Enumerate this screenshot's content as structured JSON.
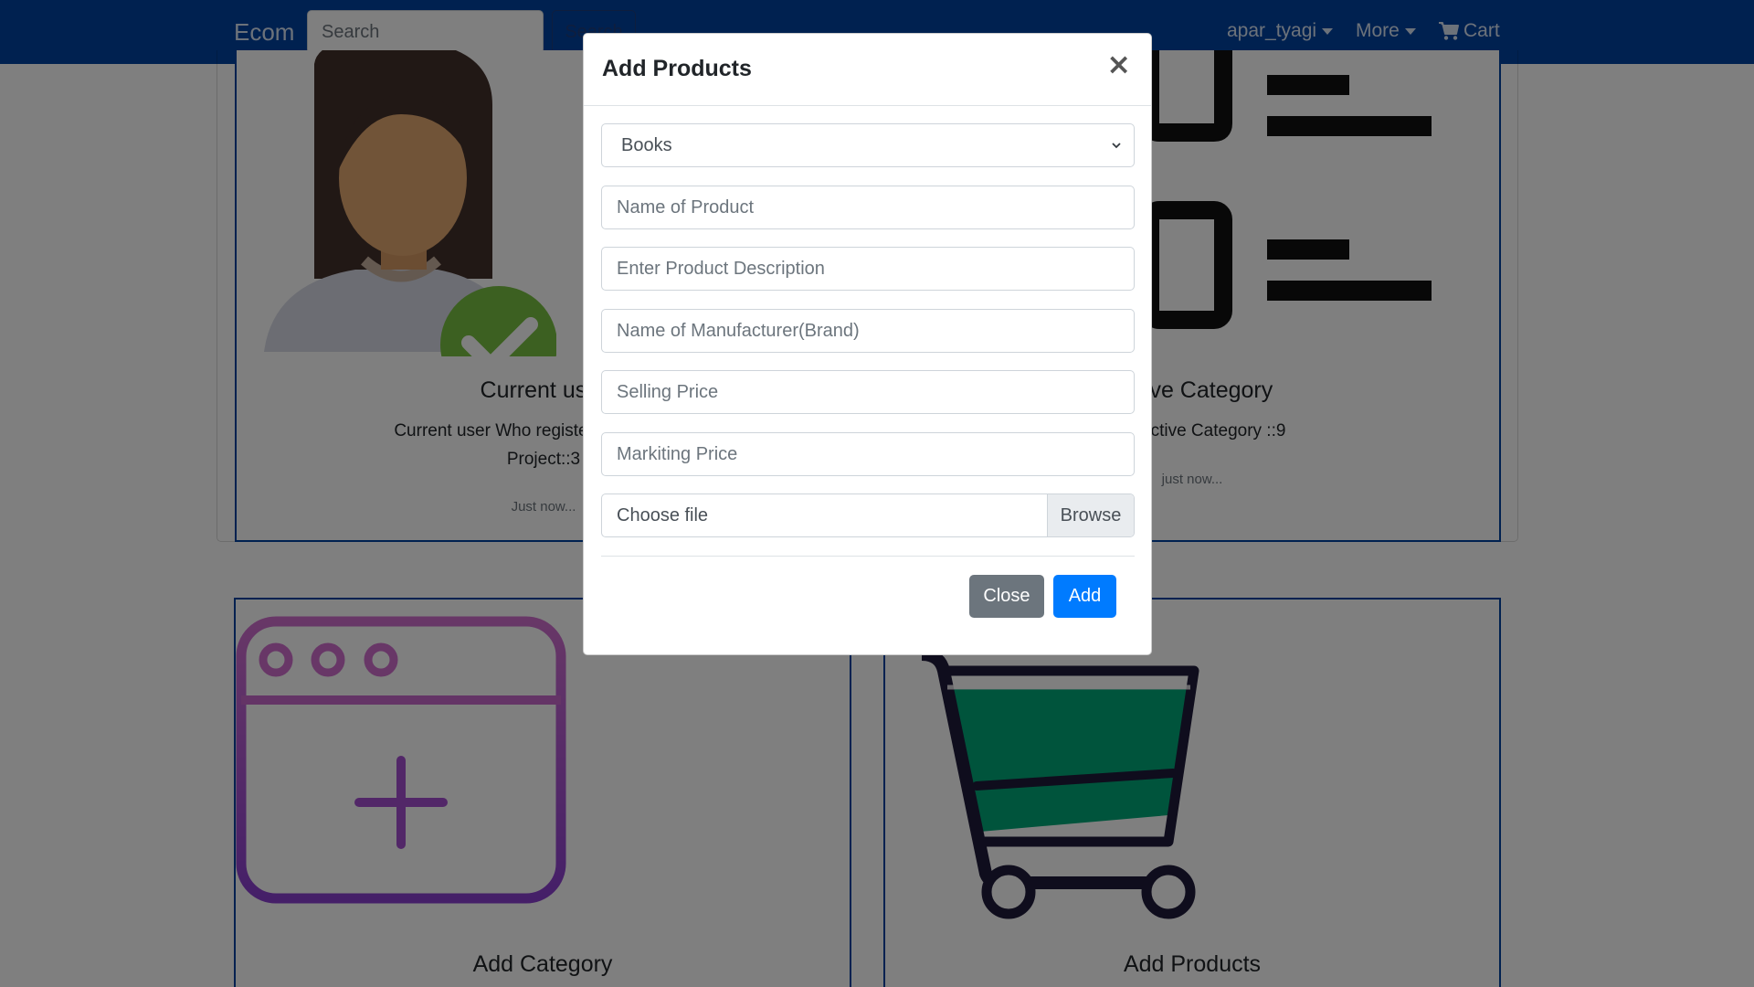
{
  "navbar": {
    "brand": "Ecom",
    "search_placeholder": "Search",
    "search_button": "Search",
    "user": "apar_tyagi",
    "more": "More",
    "cart": "Cart"
  },
  "cards": {
    "current_user": {
      "title": "Current user",
      "text_line1": "Current user Who register in this Ecom",
      "text_line2": "Project::3",
      "time": "Just now..."
    },
    "active_category": {
      "title": "Active Category",
      "text": "Total Active Category ::9",
      "time": "just now..."
    },
    "add_category": {
      "title": "Add Category"
    },
    "add_products": {
      "title": "Add Products"
    }
  },
  "modal": {
    "title": "Add Products",
    "close_symbol": "×",
    "category_select": {
      "selected": "Books"
    },
    "fields": {
      "name_placeholder": "Name of Product",
      "description_placeholder": "Enter Product Description",
      "manufacturer_placeholder": "Name of Manufacturer(Brand)",
      "selling_price_placeholder": "Selling Price",
      "marketing_price_placeholder": "Markiting Price"
    },
    "file": {
      "label": "Choose file",
      "browse": "Browse"
    },
    "buttons": {
      "close": "Close",
      "add": "Add"
    }
  },
  "colors": {
    "navbar": "#0042a0",
    "primary": "#007bff",
    "secondary": "#6c757d",
    "cart_green": "#00a878",
    "check_green": "#79c142"
  },
  "icons": {
    "current_user_card": "user-verified-icon",
    "active_category_card": "category-list-icon",
    "add_category_card": "add-window-icon",
    "add_products_card": "shopping-cart-icon"
  }
}
